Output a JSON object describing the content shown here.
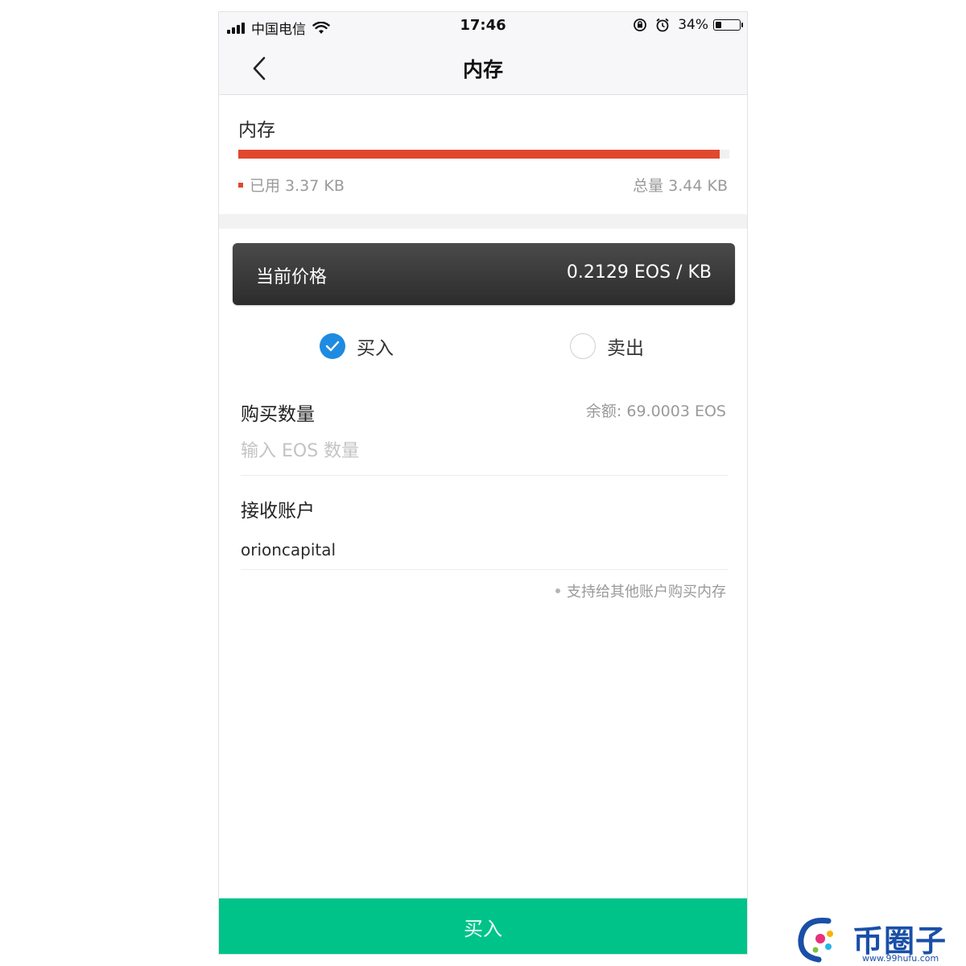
{
  "status_bar": {
    "carrier": "中国电信",
    "time": "17:46",
    "battery": "34%",
    "battery_level": 0.34
  },
  "nav": {
    "title": "内存",
    "back_icon": "chevron-left-icon"
  },
  "memory": {
    "title": "内存",
    "used": "已用 3.37 KB",
    "total": "总量 3.44 KB",
    "usage_fraction": 0.98,
    "bar_color": "#e0482f"
  },
  "price": {
    "label": "当前价格",
    "value": "0.2129 EOS / KB"
  },
  "trade_type": {
    "options": [
      {
        "label": "买入",
        "selected": true
      },
      {
        "label": "卖出",
        "selected": false
      }
    ],
    "accent": "#1e8be0"
  },
  "purchase": {
    "label": "购买数量",
    "balance": "余额: 69.0003 EOS",
    "placeholder": "输入 EOS 数量",
    "value": ""
  },
  "receiver": {
    "label": "接收账户",
    "value": "orioncapital",
    "hint": "支持给其他账户购买内存"
  },
  "submit": {
    "label": "买入",
    "color": "#00c38a"
  },
  "watermark": {
    "text": "币圈子",
    "url": "www.99hufu.com"
  }
}
